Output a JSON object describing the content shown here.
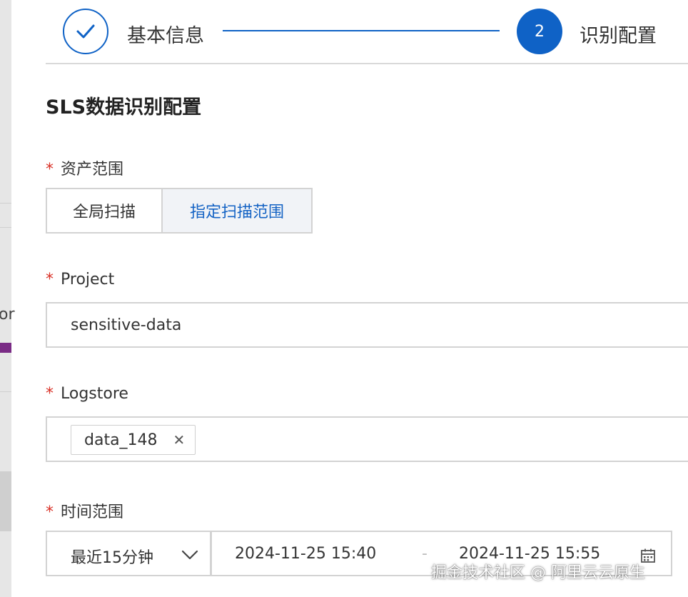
{
  "left_panel": {
    "fragment": "or"
  },
  "steps": [
    {
      "label": "基本信息",
      "status": "done",
      "icon": "check-icon"
    },
    {
      "label": "识别配置",
      "status": "active",
      "number": "2"
    }
  ],
  "section_title": "SLS数据识别配置",
  "asset_scope": {
    "required_mark": "*",
    "label": "资产范围",
    "options": [
      "全局扫描",
      "指定扫描范围"
    ],
    "selected": "指定扫描范围"
  },
  "project": {
    "required_mark": "*",
    "label": "Project",
    "value": "sensitive-data"
  },
  "logstore": {
    "required_mark": "*",
    "label": "Logstore",
    "tags": [
      "data_148"
    ]
  },
  "time_range": {
    "required_mark": "*",
    "label": "时间范围",
    "preset": "最近15分钟",
    "start": "2024-11-25 15:40",
    "separator": "-",
    "end": "2024-11-25 15:55"
  },
  "watermark": "掘金技术社区 @ 阿里云云原生",
  "colors": {
    "primary": "#0f62c6",
    "required": "#d93026",
    "selected_bg": "#f1f3f7",
    "left_accent": "#7a2b85"
  }
}
